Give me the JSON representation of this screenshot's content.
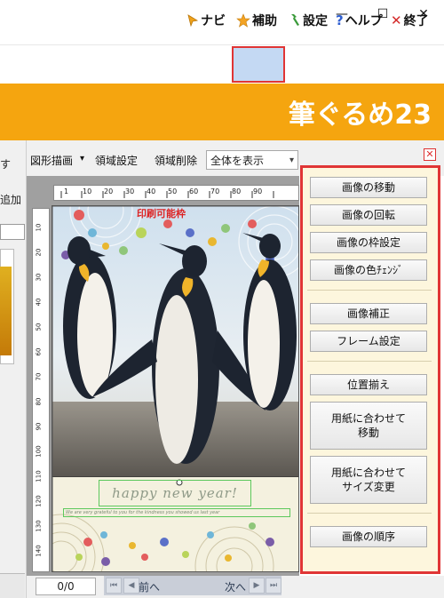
{
  "window": {
    "minimize_glyph": "—",
    "maximize_glyph": "☐",
    "close_glyph": "✕"
  },
  "menu": {
    "navi": {
      "label": "ナビ",
      "icon": "pointer-arrow-icon"
    },
    "hojo": {
      "label": "補助",
      "icon": "star-icon"
    },
    "settei": {
      "label": "設定",
      "icon": "wrench-icon"
    },
    "help": {
      "label": "ヘルプ",
      "icon": "question-icon"
    },
    "exit": {
      "label": "終了",
      "icon": "close-x-icon"
    }
  },
  "brand": {
    "logo": "筆ぐるめ23"
  },
  "left_panel": {
    "text1": "す",
    "text2": "追加"
  },
  "toolbar": {
    "shape_draw": "図形描画",
    "shape_draw_arrow": "▾",
    "region_set": "領域設定",
    "region_delete": "領域削除",
    "view_select": "全体を表示",
    "close_glyph": "✕"
  },
  "ruler": {
    "h_labels": [
      "1",
      "10",
      "20",
      "30",
      "40",
      "50",
      "60",
      "70",
      "80",
      "90"
    ],
    "v_labels": [
      "10",
      "20",
      "30",
      "40",
      "50",
      "60",
      "70",
      "80",
      "90",
      "100",
      "110",
      "120",
      "130",
      "140"
    ]
  },
  "card": {
    "top_red_text": "印刷可能枠",
    "greeting": "happy new year!",
    "subline": "We are very grateful to you for the kindness you showed us last year"
  },
  "side_panel": {
    "buttons": [
      "画像の移動",
      "画像の回転",
      "画像の枠設定",
      "画像の色ﾁｪﾝｼﾞ",
      "画像補正",
      "フレーム設定",
      "位置揃え",
      "用紙に合わせて\n移動",
      "用紙に合わせて\nサイズ変更",
      "画像の順序"
    ]
  },
  "bottom": {
    "page_counter": "0/0",
    "prev": "前へ",
    "next": "次へ"
  },
  "colors": {
    "brand": "#f5a50f",
    "highlight_border": "#e03535",
    "side_panel_bg": "#fdf6dd",
    "hojo_bg": "#c4d9f3"
  }
}
